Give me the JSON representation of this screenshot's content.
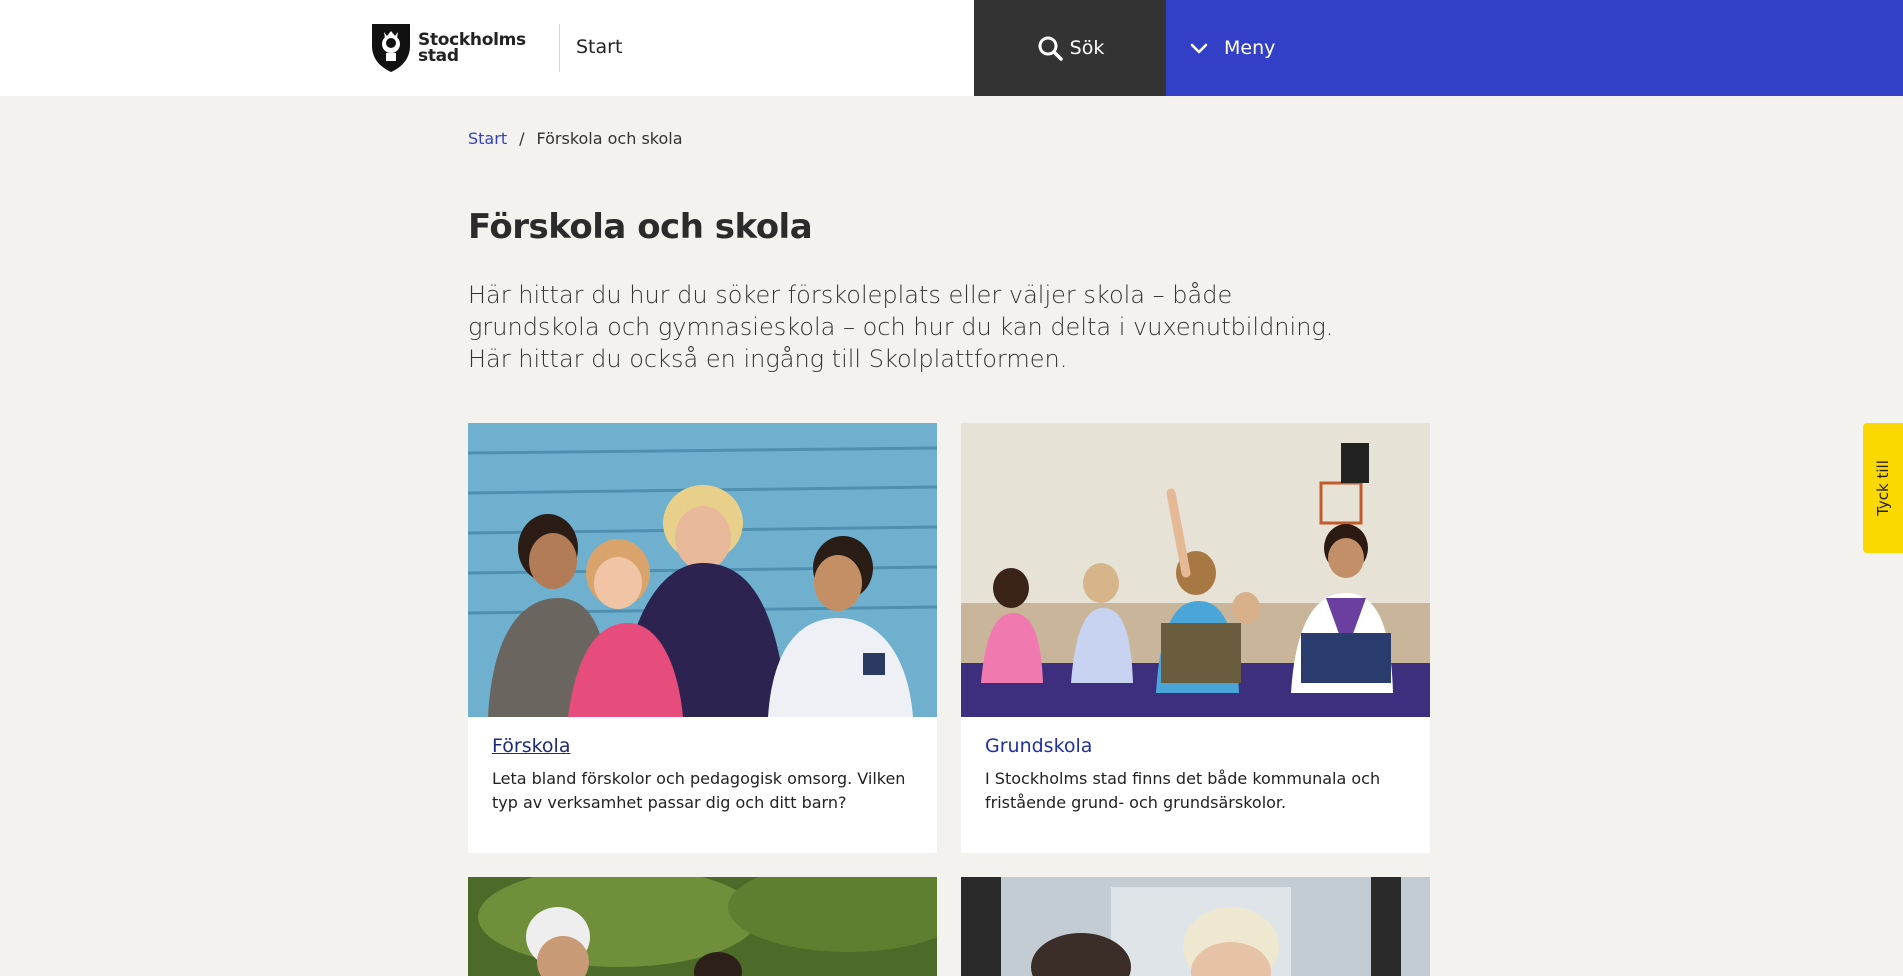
{
  "header": {
    "logo_line1": "Stockholms",
    "logo_line2": "stad",
    "start_link": "Start",
    "search_label": "Sök",
    "menu_label": "Meny"
  },
  "breadcrumb": {
    "items": [
      "Start",
      "Förskola och skola"
    ],
    "separator": "/"
  },
  "main": {
    "title": "Förskola och skola",
    "intro": "Här hittar du hur du söker förskoleplats eller väljer skola – både grundskola och gymnasieskola – och hur du kan delta i vuxenutbildning. Här hittar du också en ingång till Skolplattformen."
  },
  "cards": [
    {
      "title": "Förskola",
      "description": "Leta bland förskolor och pedagogisk omsorg. Vilken typ av verksamhet passar dig och ditt barn?"
    },
    {
      "title": "Grundskola",
      "description": "I Stockholms stad finns det både kommunala och fristående grund- och grundsärskolor."
    }
  ],
  "feedback": {
    "label": "Tyck till"
  },
  "colors": {
    "brand_blue": "#3140c7",
    "search_bg": "#333333",
    "feedback_yellow": "#fad800",
    "page_bg": "#f3f2ee"
  }
}
